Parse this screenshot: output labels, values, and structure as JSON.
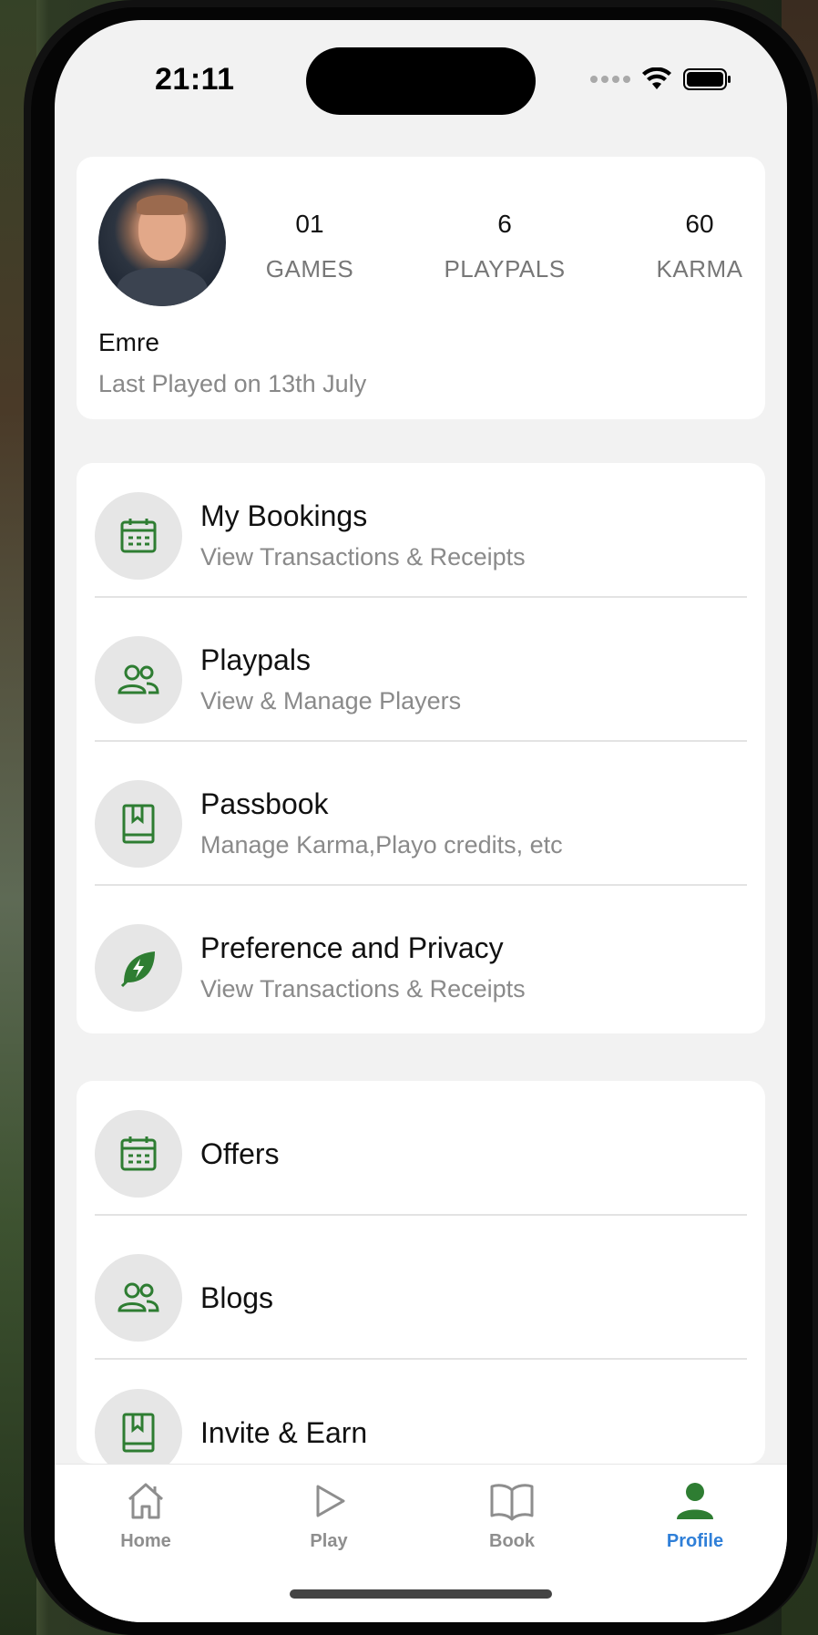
{
  "status_bar": {
    "time": "21:11"
  },
  "profile": {
    "name": "Emre",
    "last_played": "Last Played on 13th July",
    "stats": [
      {
        "value": "01",
        "label": "GAMES"
      },
      {
        "value": "6",
        "label": "PLAYPALS"
      },
      {
        "value": "60",
        "label": "KARMA"
      }
    ]
  },
  "menu_group_1": [
    {
      "icon": "calendar-icon",
      "title": "My Bookings",
      "subtitle": "View Transactions & Receipts"
    },
    {
      "icon": "people-icon",
      "title": "Playpals",
      "subtitle": "View & Manage Players"
    },
    {
      "icon": "book-icon",
      "title": "Passbook",
      "subtitle": "Manage Karma,Playo credits, etc"
    },
    {
      "icon": "leaf-bolt-icon",
      "title": "Preference and Privacy",
      "subtitle": "View Transactions & Receipts"
    }
  ],
  "menu_group_2": [
    {
      "icon": "calendar-icon",
      "title": "Offers"
    },
    {
      "icon": "people-icon",
      "title": "Blogs"
    },
    {
      "icon": "book-icon",
      "title": "Invite & Earn"
    }
  ],
  "tabs": [
    {
      "icon": "home-icon",
      "label": "Home"
    },
    {
      "icon": "play-icon",
      "label": "Play"
    },
    {
      "icon": "open-book-icon",
      "label": "Book"
    },
    {
      "icon": "person-icon",
      "label": "Profile",
      "active": true
    }
  ],
  "colors": {
    "accent_green": "#2e7d32",
    "active_tab": "#2f7fd8"
  }
}
